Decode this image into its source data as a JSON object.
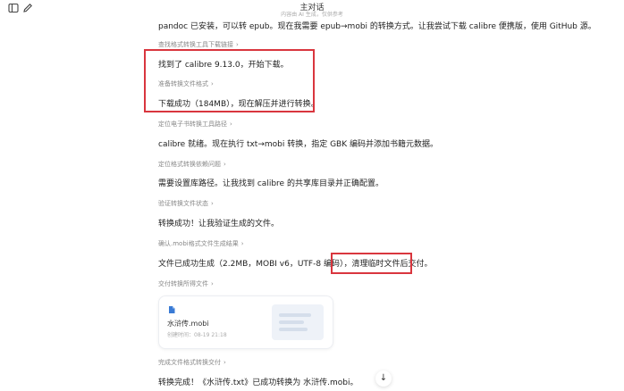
{
  "header": {
    "title": "主对话",
    "subtitle": "内容由 AI 生成，仅供参考"
  },
  "icons": {
    "sidebar": "sidebar-toggle-icon",
    "new_chat": "edit-icon",
    "chevron": "chevron-right-icon",
    "file": "document-icon",
    "scroll_down": "arrow-down-icon"
  },
  "messages": [
    {
      "type": "main",
      "text": "pandoc 已安装，可以转 epub。现在我需要 epub→mobi 的转换方式。让我尝试下载 calibre 便携版，使用 GitHub 源。"
    },
    {
      "type": "step",
      "text": "查找格式转换工具下载链接"
    },
    {
      "type": "main",
      "text": "找到了 calibre 9.13.0，开始下载。"
    },
    {
      "type": "step",
      "text": "准备转换文件格式"
    },
    {
      "type": "main",
      "text": "下载成功（184MB），现在解压并进行转换。"
    },
    {
      "type": "step",
      "text": "定位电子书转换工具路径"
    },
    {
      "type": "main",
      "text": "calibre 就绪。现在执行 txt→mobi 转换，指定 GBK 编码并添加书籍元数据。"
    },
    {
      "type": "step",
      "text": "定位格式转换依赖问题"
    },
    {
      "type": "main",
      "text": "需要设置库路径。让我找到 calibre 的共享库目录并正确配置。"
    },
    {
      "type": "step",
      "text": "验证转换文件状态"
    },
    {
      "type": "main",
      "text": "转换成功！让我验证生成的文件。"
    },
    {
      "type": "step",
      "text": "确认.mobi格式文件生成结果"
    },
    {
      "type": "main",
      "text": "文件已成功生成（2.2MB，MOBI v6，UTF-8 编码），清理临时文件后交付。"
    },
    {
      "type": "step",
      "text": "交付转换所得文件"
    },
    {
      "type": "step",
      "text": "完成文件格式转换交付"
    },
    {
      "type": "main",
      "text": "转换完成！《水浒传.txt》已成功转换为 水浒传.mobi。"
    }
  ],
  "file_card": {
    "name": "水浒传.mobi",
    "meta": "创建时间：08-19 21:18"
  },
  "colors": {
    "highlight": "#d9363e",
    "accent": "#3a7bd5"
  }
}
